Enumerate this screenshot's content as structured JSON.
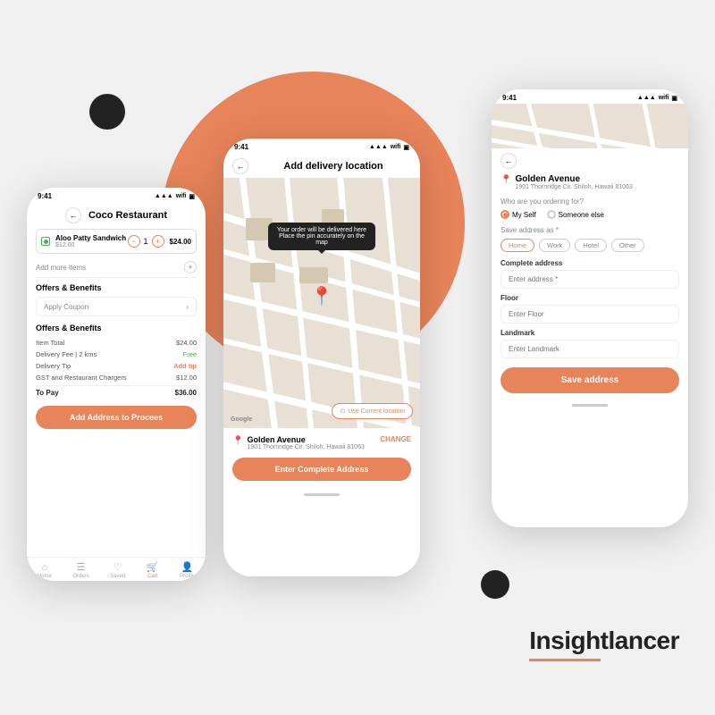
{
  "background": {
    "circle_color": "#e8845a",
    "dot_color": "#222222"
  },
  "brand": {
    "name": "Insightlancer"
  },
  "phone1": {
    "time": "9:41",
    "title": "Coco Restaurant",
    "item": {
      "name": "Aloo Patty Sandwich",
      "price": "$12.00",
      "quantity": "1",
      "total": "$24.00"
    },
    "add_more": "Add more items",
    "sections": [
      {
        "title": "Offers & Benefits",
        "coupon": "Apply Coupon"
      },
      {
        "title": "Offers & Benefits"
      }
    ],
    "bill": {
      "item_total_label": "Item Total",
      "item_total_value": "$24.00",
      "delivery_label": "Delivery Fee | 2 kms",
      "delivery_value": "Free",
      "tip_label": "Delivery Tip",
      "tip_value": "Add tip",
      "gst_label": "GST and Restaurant Chargers",
      "gst_value": "$12.00",
      "total_label": "To Pay",
      "total_value": "$36.00"
    },
    "cta": "Add Address to Procees",
    "nav": [
      "Home",
      "Orders",
      "Saved",
      "Cart",
      "Profile"
    ]
  },
  "phone2": {
    "time": "9:41",
    "title": "Add delivery location",
    "map_tooltip": "Your order will be delivered here Place the pin accurately on the map",
    "use_location": "Use Current location",
    "location": {
      "name": "Golden Avenue",
      "address": "1901 Thornridge Cir. Shiloh, Hawaii 81063"
    },
    "change_label": "CHANGE",
    "cta": "Enter Complete Address"
  },
  "phone3": {
    "time": "9:41",
    "location": {
      "name": "Golden Avenue",
      "address": "1901 Thornridge Cir. Shiloh, Hawaii 81063"
    },
    "ordering_for_label": "Who are you ordering for?",
    "radio_options": [
      "My Self",
      "Someone else"
    ],
    "save_as_label": "Save address as *",
    "save_tags": [
      "Home",
      "Work",
      "Hotel",
      "Other"
    ],
    "complete_address_label": "Complete address",
    "address_placeholder": "Enter address *",
    "floor_label": "Floor",
    "floor_placeholder": "Enter Floor",
    "landmark_label": "Landmark",
    "landmark_placeholder": "Enter Landmark",
    "cta": "Save address"
  }
}
